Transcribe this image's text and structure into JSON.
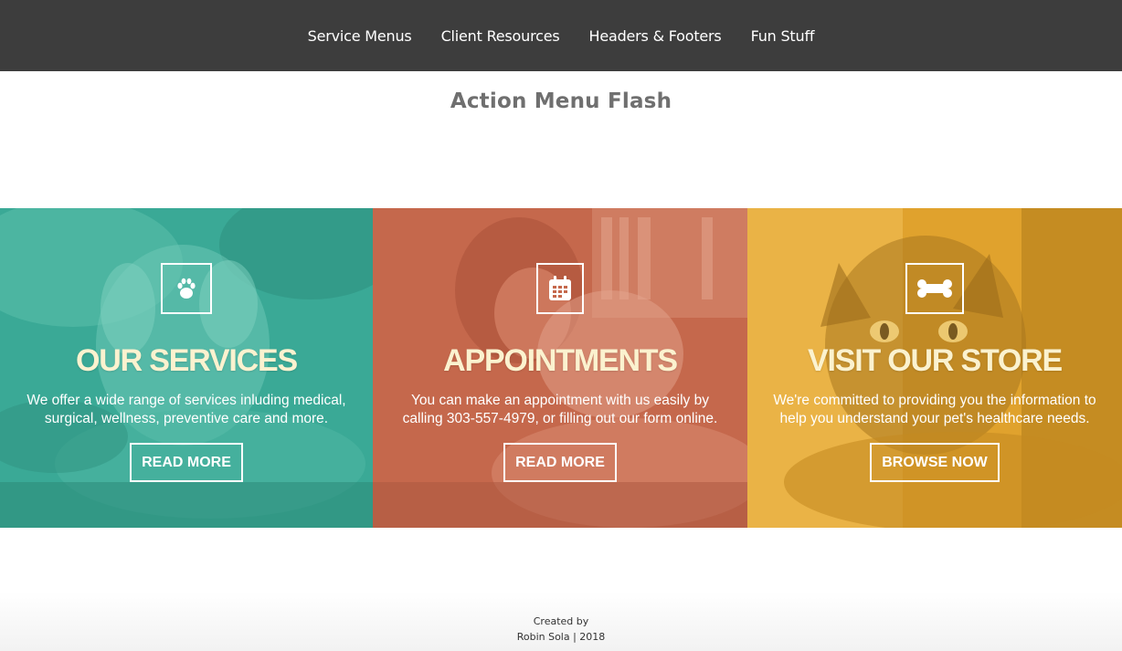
{
  "nav": {
    "items": [
      {
        "label": "Service Menus"
      },
      {
        "label": "Client Resources"
      },
      {
        "label": "Headers & Footers"
      },
      {
        "label": "Fun Stuff"
      }
    ]
  },
  "page": {
    "title": "Action Menu Flash"
  },
  "panels": [
    {
      "icon": "paw-icon",
      "heading": "OUR SERVICES",
      "text": "We offer a wide range of services inluding medical, surgical, wellness, preventive care and more.",
      "button": "READ MORE",
      "color": "#3aa996"
    },
    {
      "icon": "calendar-icon",
      "heading": "APPOINTMENTS",
      "text": "You can make an appointment with us easily by calling 303-557-4979, or filling out our form online.",
      "button": "READ MORE",
      "color": "#c5684c"
    },
    {
      "icon": "bone-icon",
      "heading": "VISIT OUR STORE",
      "text": "We're committed to providing you the information to help you understand your pet's healthcare needs.",
      "button": "BROWSE NOW",
      "color": "#e0a22d"
    }
  ],
  "footer": {
    "line1": "Created by",
    "line2": "Robin Sola | 2018"
  }
}
